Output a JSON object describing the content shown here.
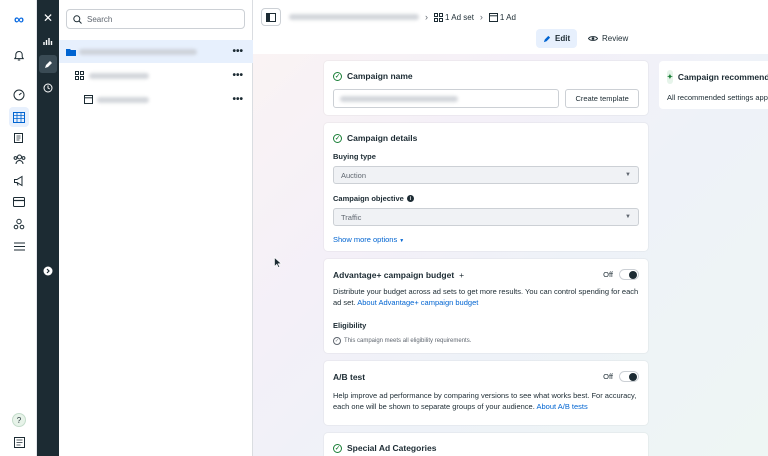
{
  "search": {
    "placeholder": "Search"
  },
  "breadcrumb": {
    "adset": "1 Ad set",
    "ad": "1 Ad"
  },
  "modes": {
    "edit": "Edit",
    "review": "Review"
  },
  "campaign_name": {
    "title": "Campaign name",
    "create_template": "Create template"
  },
  "campaign_details": {
    "title": "Campaign details",
    "buying_type_label": "Buying type",
    "buying_type_value": "Auction",
    "objective_label": "Campaign objective",
    "objective_value": "Traffic",
    "show_more": "Show more options"
  },
  "budget": {
    "title": "Advantage+ campaign budget",
    "state": "Off",
    "desc": "Distribute your budget across ad sets to get more results. You can control spending for each ad set.",
    "link": "About Advantage+ campaign budget",
    "eligibility_label": "Eligibility",
    "eligibility_text": "This campaign meets all eligibility requirements."
  },
  "ab_test": {
    "title": "A/B test",
    "state": "Off",
    "desc": "Help improve ad performance by comparing versions to see what works best. For accuracy, each one will be shown to separate groups of your audience.",
    "link": "About A/B tests"
  },
  "special": {
    "title": "Special Ad Categories"
  },
  "recommend": {
    "title": "Campaign recommendations",
    "text": "All recommended settings applied"
  },
  "colors": {
    "accent": "#0064d1",
    "dark_rail": "#1c2b33",
    "selected": "#e7f0fd",
    "success": "#1a7f37"
  }
}
